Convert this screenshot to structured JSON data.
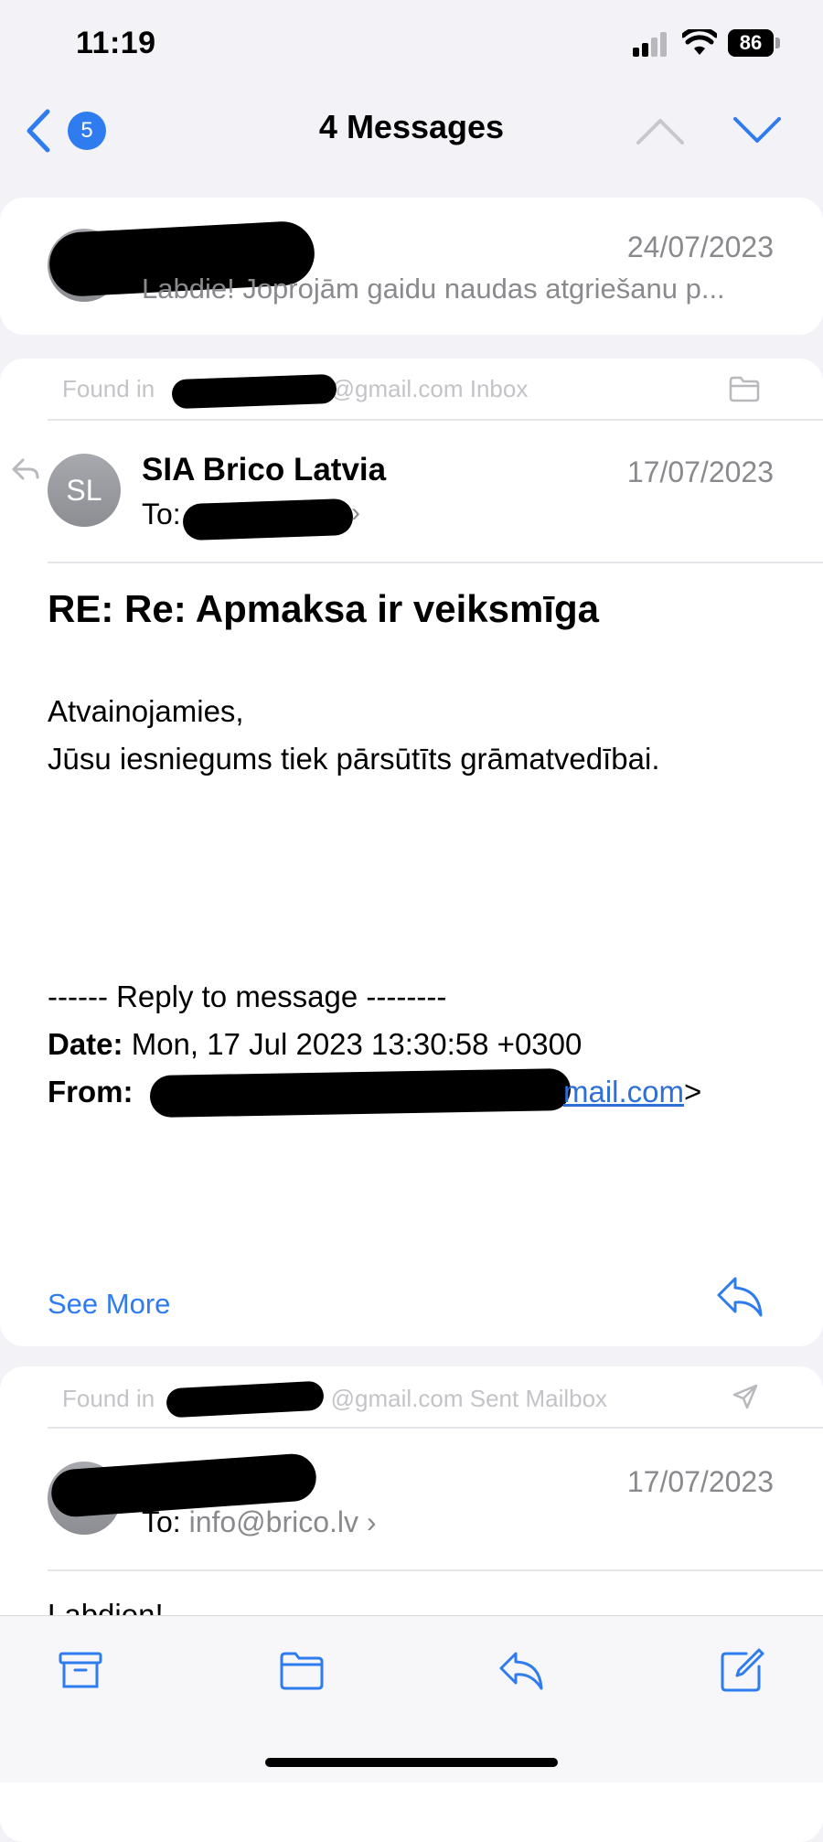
{
  "status_bar": {
    "time": "11:19",
    "battery": "86"
  },
  "nav": {
    "badge": "5",
    "title": "4 Messages"
  },
  "messages": [
    {
      "date": "24/07/2023",
      "preview": "Labdie! Joprojām gaidu naudas atgriešanu p..."
    },
    {
      "found_prefix": "Found in",
      "found_suffix": "@gmail.com Inbox",
      "avatar_initials": "SL",
      "sender": "SIA Brico Latvia",
      "date": "17/07/2023",
      "to_label": "To:",
      "subject": "RE: Re: Apmaksa ir veiksmīga",
      "body_lines": [
        "Atvainojamies,",
        "Jūsu iesniegums tiek pārsūtīts grāmatvedībai."
      ],
      "reply_header": "------ Reply to message --------",
      "date_label": "Date:",
      "date_value": "Mon, 17 Jul 2023 13:30:58 +0300",
      "from_label": "From:",
      "from_link_tail": "mail.com",
      "from_tail": ">",
      "see_more": "See More"
    },
    {
      "found_prefix": "Found in",
      "found_suffix": "@gmail.com Sent Mailbox",
      "date": "17/07/2023",
      "to_label": "To:",
      "to_address": "info@brico.lv",
      "body_start": "Labdien!"
    }
  ],
  "icons": {
    "back": "chevron-left-icon",
    "up": "chevron-up-icon",
    "down": "chevron-down-icon",
    "folder": "folder-icon",
    "sent": "paper-plane-icon",
    "reply": "reply-icon",
    "archive": "archive-icon",
    "compose": "compose-icon"
  },
  "colors": {
    "accent": "#2f7bf0",
    "background": "#f2f2f7",
    "secondary_text": "#8a8a8e"
  }
}
